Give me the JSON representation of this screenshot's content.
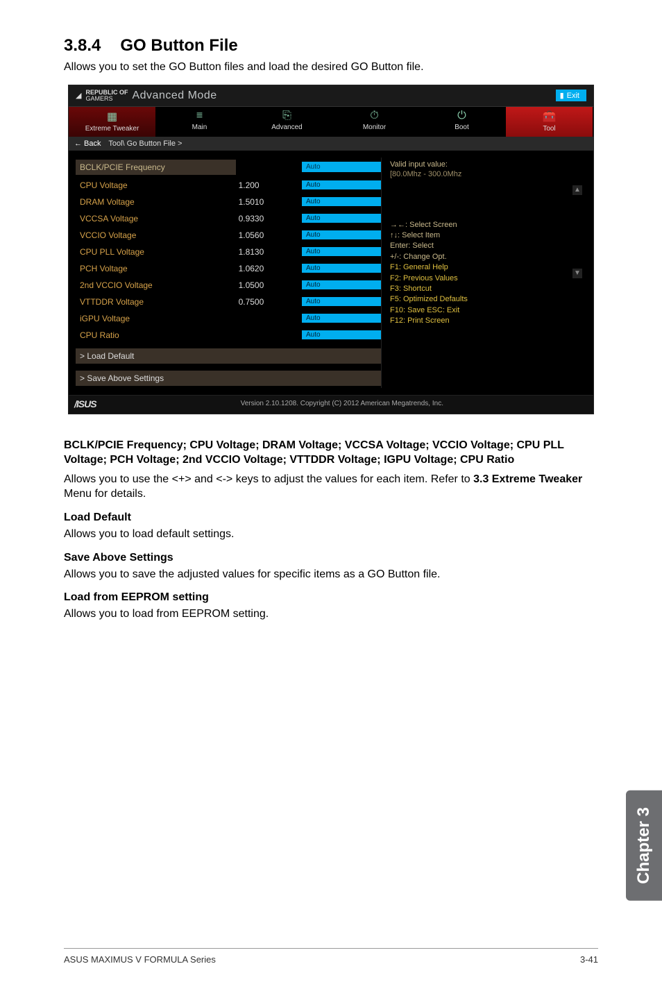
{
  "section": {
    "number": "3.8.4",
    "title": "GO Button File",
    "intro": "Allows you to set the GO Button files and load the desired GO Button file."
  },
  "bios": {
    "brand_top": "REPUBLIC OF",
    "brand_bottom": "GAMERS",
    "mode": "Advanced Mode",
    "exit": "Exit",
    "tabs": {
      "t1": "Extreme Tweaker",
      "t2": "Main",
      "t3": "Advanced",
      "t4": "Monitor",
      "t5": "Boot",
      "t6": "Tool"
    },
    "breadcrumb_back": "← Back",
    "breadcrumb_path": "Tool\\ Go Button File >",
    "header_label": "BCLK/PCIE Frequency",
    "header_input": "Auto",
    "rows": {
      "r1_label": "CPU Voltage",
      "r1_val": "1.200",
      "r1_in": "Auto",
      "r2_label": "DRAM Voltage",
      "r2_val": "1.5010",
      "r2_in": "Auto",
      "r3_label": "VCCSA Voltage",
      "r3_val": "0.9330",
      "r3_in": "Auto",
      "r4_label": "VCCIO Voltage",
      "r4_val": "1.0560",
      "r4_in": "Auto",
      "r5_label": "CPU PLL Voltage",
      "r5_val": "1.8130",
      "r5_in": "Auto",
      "r6_label": "PCH Voltage",
      "r6_val": "1.0620",
      "r6_in": "Auto",
      "r7_label": "2nd VCCIO Voltage",
      "r7_val": "1.0500",
      "r7_in": "Auto",
      "r8_label": "VTTDDR Voltage",
      "r8_val": "0.7500",
      "r8_in": "Auto",
      "r9_label": "iGPU Voltage",
      "r9_val": "",
      "r9_in": "Auto",
      "r10_label": "CPU Ratio",
      "r10_val": "",
      "r10_in": "Auto"
    },
    "btn1": "> Load Default",
    "btn2": "> Save Above Settings",
    "help_valid": "Valid input value:",
    "help_range": "[80.0Mhz - 300.0Mhz",
    "keys": {
      "k1": "→←: Select Screen",
      "k2": "↑↓: Select Item",
      "k3": "Enter: Select",
      "k4": "+/-: Change Opt.",
      "k5": "F1: General Help",
      "k6": "F2: Previous Values",
      "k7": "F3: Shortcut",
      "k8": "F5: Optimized Defaults",
      "k9": "F10: Save  ESC: Exit",
      "k10": "F12: Print Screen"
    },
    "footer_brand": "/ISUS",
    "footer_text": "Version 2.10.1208. Copyright (C) 2012 American Megatrends, Inc."
  },
  "doc": {
    "group_heading": "BCLK/PCIE Frequency; CPU Voltage; DRAM Voltage; VCCSA Voltage; VCCIO Voltage; CPU PLL Voltage; PCH Voltage; 2nd VCCIO Voltage; VTTDDR Voltage; IGPU Voltage; CPU Ratio",
    "group_body_1": "Allows you to use the <+> and <-> keys to adjust the values for each item. Refer to ",
    "group_body_bold": "3.3 Extreme Tweaker",
    "group_body_2": " Menu for details.",
    "h_load_default": "Load Default",
    "p_load_default": "Allows you to load default settings.",
    "h_save_above": "Save Above Settings",
    "p_save_above": "Allows you to save the adjusted values for specific items as a GO Button file.",
    "h_load_eeprom": "Load from EEPROM setting",
    "p_load_eeprom": "Allows you to load from EEPROM setting."
  },
  "chapter_tab": "Chapter 3",
  "footer_left": "ASUS MAXIMUS V FORMULA Series",
  "footer_right": "3-41"
}
